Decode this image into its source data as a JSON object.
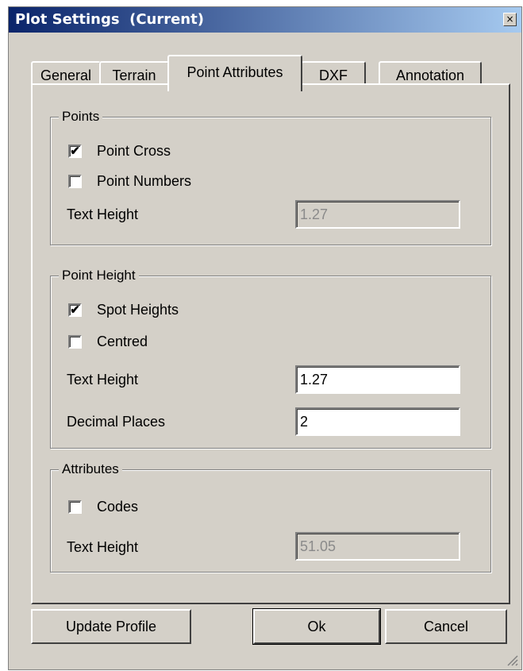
{
  "window": {
    "title": "Plot Settings  (Current)",
    "close_label": "×"
  },
  "tabs": [
    {
      "label": "General"
    },
    {
      "label": "Terrain"
    },
    {
      "label": "Point Attributes"
    },
    {
      "label": "DXF"
    },
    {
      "label": "Annotation"
    }
  ],
  "active_tab": "Point Attributes",
  "points": {
    "legend": "Points",
    "point_cross": {
      "label": "Point Cross",
      "checked": true,
      "mark": "✔"
    },
    "point_numbers": {
      "label": "Point Numbers",
      "checked": false,
      "mark": ""
    },
    "text_height": {
      "label": "Text Height",
      "value": "1.27",
      "enabled": false
    }
  },
  "point_height": {
    "legend": "Point Height",
    "spot_heights": {
      "label": "Spot Heights",
      "checked": true,
      "mark": "✔"
    },
    "centred": {
      "label": "Centred",
      "checked": false,
      "mark": ""
    },
    "text_height": {
      "label": "Text Height",
      "value": "1.27",
      "enabled": true
    },
    "decimal_places": {
      "label": "Decimal Places",
      "value": "2",
      "enabled": true
    }
  },
  "attributes": {
    "legend": "Attributes",
    "codes": {
      "label": "Codes",
      "checked": false,
      "mark": ""
    },
    "text_height": {
      "label": "Text Height",
      "value": "51.05",
      "enabled": false
    }
  },
  "buttons": {
    "update_profile": "Update Profile",
    "ok": "Ok",
    "cancel": "Cancel"
  },
  "colors": {
    "titlebar_start": "#0a246a",
    "titlebar_end": "#a6caf0",
    "face": "#d4d0c8"
  }
}
